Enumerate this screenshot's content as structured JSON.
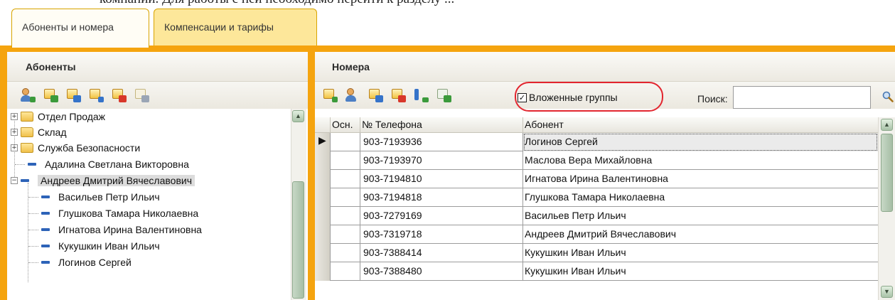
{
  "doc_text": "компании. Для работы с ней необходимо перейти к разделу ...",
  "tabs": [
    {
      "label": "Абоненты и номера",
      "active": true
    },
    {
      "label": "Компенсации и тарифы",
      "active": false
    }
  ],
  "left_panel": {
    "title": "Абоненты",
    "toolbar_icons": [
      "add-subscriber-icon",
      "add-group-icon",
      "edit-icon",
      "move-icon",
      "delete-icon",
      "import-icon"
    ],
    "tree": [
      {
        "label": "Отдел Продаж",
        "type": "group",
        "expanded": false
      },
      {
        "label": "Склад",
        "type": "group",
        "expanded": false
      },
      {
        "label": "Служба Безопасности",
        "type": "group",
        "expanded": false
      },
      {
        "label": "Адалина Светлана Викторовна",
        "type": "subscriber"
      },
      {
        "label": "Андреев Дмитрий Вячеславович",
        "type": "subscriber",
        "expanded": true,
        "selected": true
      },
      {
        "label": "Васильев Петр Ильич",
        "type": "child"
      },
      {
        "label": "Глушкова Тамара Николаевна",
        "type": "child"
      },
      {
        "label": "Игнатова Ирина Валентиновна",
        "type": "child"
      },
      {
        "label": "Кукушкин Иван Ильич",
        "type": "child"
      },
      {
        "label": "Логинов Сергей",
        "type": "child"
      }
    ]
  },
  "right_panel": {
    "title": "Номера",
    "toolbar_icons": [
      "add-number-icon",
      "assign-subscriber-icon",
      "edit-number-icon",
      "delete-number-icon",
      "hierarchy-icon",
      "export-excel-icon"
    ],
    "nested_groups_label": "Вложенные группы",
    "nested_groups_checked": true,
    "search_label": "Поиск:",
    "search_value": "",
    "columns": [
      "Осн.",
      "№ Телефона",
      "Абонент"
    ],
    "rows": [
      {
        "phone": "903-7193936",
        "subscriber": "Логинов Сергей",
        "current": true
      },
      {
        "phone": "903-7193970",
        "subscriber": "Маслова Вера Михайловна"
      },
      {
        "phone": "903-7194810",
        "subscriber": "Игнатова Ирина Валентиновна"
      },
      {
        "phone": "903-7194818",
        "subscriber": "Глушкова Тамара Николаевна"
      },
      {
        "phone": "903-7279169",
        "subscriber": "Васильев Петр Ильич"
      },
      {
        "phone": "903-7319718",
        "subscriber": "Андреев Дмитрий Вячеславович"
      },
      {
        "phone": "903-7388414",
        "subscriber": "Кукушкин Иван Ильич"
      },
      {
        "phone": "903-7388480",
        "subscriber": "Кукушкин Иван Ильич"
      }
    ]
  },
  "colors": {
    "frame": "#f5a40f",
    "tab_inactive": "#fde79a",
    "highlight": "#e2262f"
  }
}
